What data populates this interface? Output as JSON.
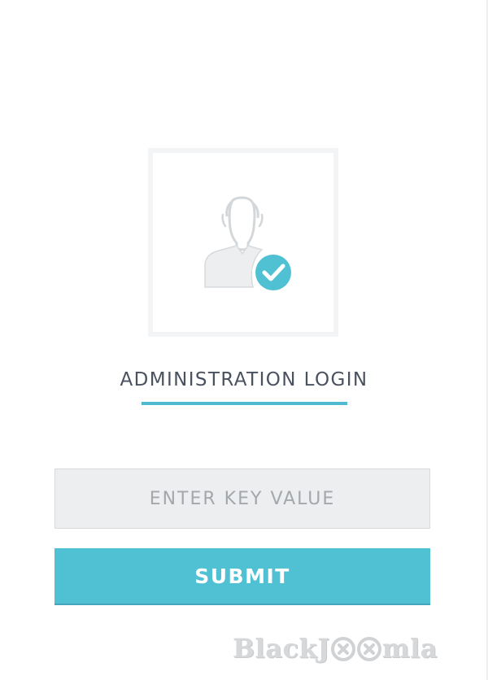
{
  "header": {
    "title": "ADMINISTRATION LOGIN"
  },
  "avatar": {
    "icon": "user-verified-icon",
    "badge_icon": "checkmark-icon"
  },
  "form": {
    "key_placeholder": "ENTER KEY VALUE",
    "key_value": "",
    "submit_label": "SUBMIT"
  },
  "watermark": {
    "text_before": "BlackJ",
    "text_after": "mla"
  },
  "colors": {
    "accent": "#4fc1d3",
    "underline": "#4fb9cf",
    "title_text": "#4a5260",
    "input_bg": "#eceeef",
    "placeholder": "#a4a8ac",
    "avatar_silhouette": "#eceeef",
    "frame": "#f3f4f5",
    "watermark": "#d6d8da"
  }
}
